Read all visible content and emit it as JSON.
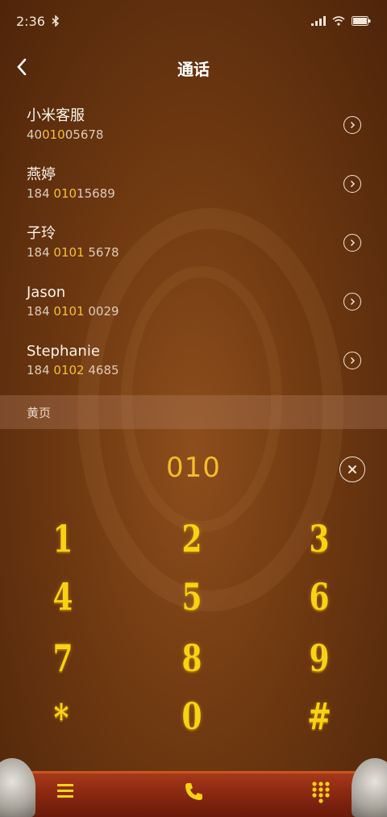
{
  "status_bar": {
    "time": "2:36"
  },
  "header": {
    "title": "通话"
  },
  "contacts": [
    {
      "name": "小米客服",
      "number_pre": "40",
      "number_hl": "010",
      "number_post": "05678"
    },
    {
      "name": "燕婷",
      "number_pre": "184 ",
      "number_hl": "010",
      "number_post": "15689"
    },
    {
      "name": "子玲",
      "number_pre": "184 ",
      "number_hl": "0101",
      "number_post": " 5678"
    },
    {
      "name": "Jason",
      "number_pre": "184 ",
      "number_hl": "0101",
      "number_post": " 0029"
    },
    {
      "name": "Stephanie",
      "number_pre": "184 ",
      "number_hl": "0102",
      "number_post": " 4685"
    }
  ],
  "yellow_pages": {
    "label": "黄页"
  },
  "dialer": {
    "number": "010",
    "keys": [
      "1",
      "2",
      "3",
      "4",
      "5",
      "6",
      "7",
      "8",
      "9",
      "*",
      "0",
      "#"
    ]
  },
  "bottom_nav": {
    "items": [
      {
        "icon": "menu-icon"
      },
      {
        "icon": "phone-icon"
      },
      {
        "icon": "keypad-icon"
      }
    ]
  },
  "colors": {
    "highlight": "#f4c035",
    "keys": "#f7d312",
    "background": "#6f3911"
  }
}
